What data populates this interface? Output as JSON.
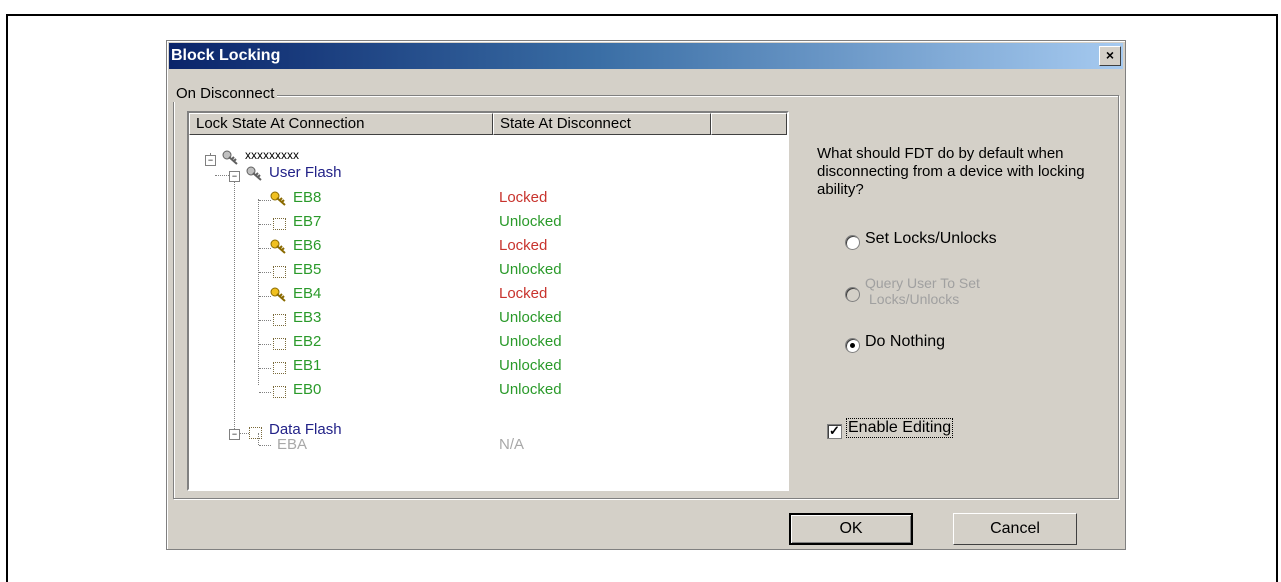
{
  "window": {
    "title": "Block Locking",
    "close_glyph": "×"
  },
  "group": {
    "label": "On Disconnect"
  },
  "tree": {
    "columns": [
      "Lock State At Connection",
      "State At Disconnect"
    ],
    "root": {
      "label": "xxxxxxxxx",
      "icon": "key-icon"
    },
    "user_flash": {
      "label": "User Flash",
      "icon": "key-icon"
    },
    "blocks": [
      {
        "name": "EB8",
        "state": "Locked",
        "icon": "key-icon"
      },
      {
        "name": "EB7",
        "state": "Unlocked",
        "icon": "unlocked-box-icon"
      },
      {
        "name": "EB6",
        "state": "Locked",
        "icon": "key-icon"
      },
      {
        "name": "EB5",
        "state": "Unlocked",
        "icon": "unlocked-box-icon"
      },
      {
        "name": "EB4",
        "state": "Locked",
        "icon": "key-icon"
      },
      {
        "name": "EB3",
        "state": "Unlocked",
        "icon": "unlocked-box-icon"
      },
      {
        "name": "EB2",
        "state": "Unlocked",
        "icon": "unlocked-box-icon"
      },
      {
        "name": "EB1",
        "state": "Unlocked",
        "icon": "unlocked-box-icon"
      },
      {
        "name": "EB0",
        "state": "Unlocked",
        "icon": "unlocked-box-icon"
      }
    ],
    "data_flash": {
      "label": "Data Flash",
      "icon": "unlocked-box-icon"
    },
    "data_blocks": [
      {
        "name": "EBA",
        "state": "N/A"
      }
    ]
  },
  "question": "What should FDT do by default when disconnecting from a device with locking ability?",
  "options": {
    "set_locks": {
      "label": "Set Locks/Unlocks",
      "checked": false,
      "enabled": true
    },
    "query_user_line1": "Query User To Set",
    "query_user_line2": "Locks/Unlocks",
    "do_nothing": {
      "label": "Do Nothing",
      "checked": true,
      "enabled": true
    }
  },
  "enable_editing": {
    "label": "Enable Editing",
    "checked": true,
    "check_glyph": "✓"
  },
  "buttons": {
    "ok": "OK",
    "cancel": "Cancel"
  },
  "colors": {
    "locked": "#c8332d",
    "unlocked": "#2a9a2a",
    "node_blue": "#222288",
    "disabled": "#a8a8a8",
    "titlebar": "#0a246a"
  },
  "expander_glyph": "−"
}
